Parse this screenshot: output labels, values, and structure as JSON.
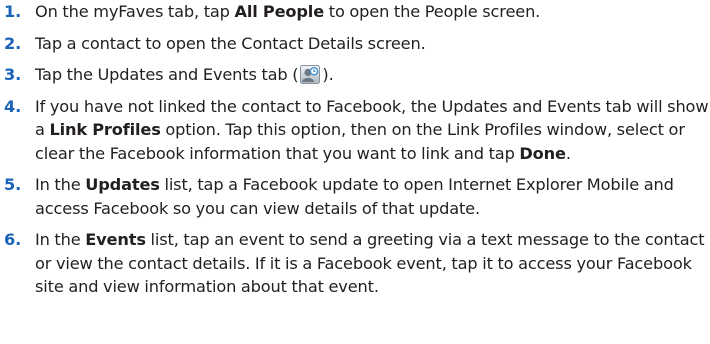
{
  "steps": [
    {
      "number": "1.",
      "parts": [
        {
          "t": "On the myFaves tab, tap "
        },
        {
          "t": "All People",
          "bold": true
        },
        {
          "t": " to open the People screen."
        }
      ]
    },
    {
      "number": "2.",
      "parts": [
        {
          "t": "Tap a contact to open the Contact Details screen."
        }
      ]
    },
    {
      "number": "3.",
      "parts": [
        {
          "t": "Tap the Updates and Events tab ("
        },
        {
          "icon": "updates-events-tab-icon"
        },
        {
          "t": ")."
        }
      ]
    },
    {
      "number": "4.",
      "parts": [
        {
          "t": "If you have not linked the contact to Facebook, the Updates and Events tab will show a "
        },
        {
          "t": "Link Profiles",
          "bold": true
        },
        {
          "t": " option. Tap this option, then on the Link Profiles window, select or clear the Facebook information that you want to link and tap "
        },
        {
          "t": "Done",
          "bold": true
        },
        {
          "t": "."
        }
      ]
    },
    {
      "number": "5.",
      "parts": [
        {
          "t": "In the "
        },
        {
          "t": "Updates",
          "bold": true
        },
        {
          "t": " list, tap a Facebook update to open Internet Explorer Mobile and access Facebook so you can view details of that update."
        }
      ]
    },
    {
      "number": "6.",
      "parts": [
        {
          "t": "In the "
        },
        {
          "t": "Events",
          "bold": true
        },
        {
          "t": " list, tap an event to send a greeting via a text message to the contact or view the contact details. If it is a Facebook event, tap it to access your Facebook site and view information about that event."
        }
      ]
    }
  ],
  "colors": {
    "step_number": "#1a63b8",
    "body_text": "#231f20"
  }
}
